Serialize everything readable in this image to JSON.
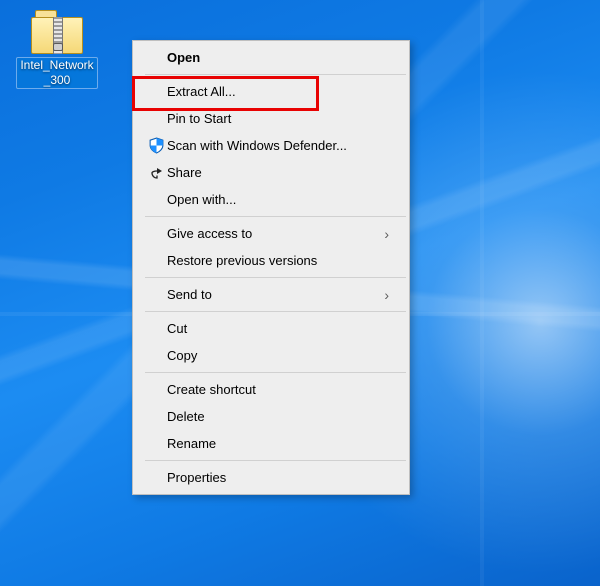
{
  "desktop": {
    "icon_label": "Intel_Network_300"
  },
  "menu": {
    "open": "Open",
    "extract_all": "Extract All...",
    "pin_to_start": "Pin to Start",
    "defender": "Scan with Windows Defender...",
    "share": "Share",
    "open_with": "Open with...",
    "give_access": "Give access to",
    "restore_prev": "Restore previous versions",
    "send_to": "Send to",
    "cut": "Cut",
    "copy": "Copy",
    "create_shortcut": "Create shortcut",
    "delete": "Delete",
    "rename": "Rename",
    "properties": "Properties"
  },
  "highlight": {
    "target": "extract_all"
  }
}
